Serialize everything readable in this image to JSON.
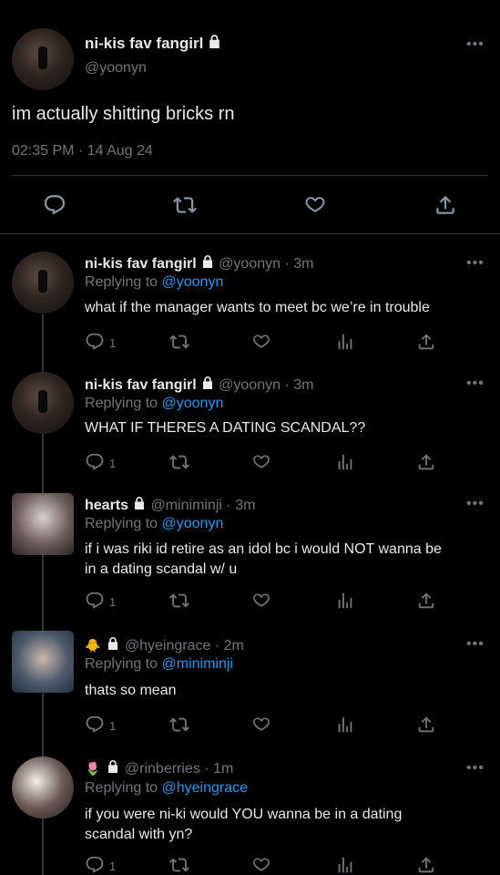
{
  "main": {
    "author_name": "ni-kis fav fangirl",
    "author_handle": "@yoonyn",
    "text": "im actually shitting bricks rn",
    "timestamp": "02:35 PM · 14 Aug 24"
  },
  "replies": [
    {
      "name": "ni-kis fav fangirl",
      "handle": "@yoonyn",
      "time": "· 3m",
      "replying_label": "Replying to",
      "replying_to": "@yoonyn",
      "text_lines": [
        "what if the manager wants to meet bc we’re in trouble"
      ],
      "reply_count": "1"
    },
    {
      "name": "ni-kis fav fangirl",
      "handle": "@yoonyn",
      "time": "· 3m",
      "replying_label": "Replying to",
      "replying_to": "@yoonyn",
      "text_lines": [
        "WHAT IF THERES A DATING SCANDAL??"
      ],
      "reply_count": "1"
    },
    {
      "name": "hearts",
      "handle": "@miniminji",
      "time": "· 3m",
      "replying_label": "Replying to",
      "replying_to": "@yoonyn",
      "text_lines": [
        "if i was riki id retire as an idol bc i would NOT wanna be",
        "in a dating scandal w/ u"
      ],
      "reply_count": "1"
    },
    {
      "name_emoji": "🐥",
      "handle": "@hyeingrace",
      "time": "· 2m",
      "replying_label": "Replying to",
      "replying_to": "@miniminji",
      "text_lines": [
        "thats so mean"
      ],
      "reply_count": "1"
    },
    {
      "name_emoji": "🌷",
      "handle": "@rinberries",
      "time": "· 1m",
      "replying_label": "Replying to",
      "replying_to": "@hyeingrace",
      "text_lines": [
        "if you were ni-ki would YOU wanna be in a dating",
        "scandal with yn?"
      ],
      "reply_count": "1"
    }
  ],
  "icons": {
    "more": "more-horizontal-icon",
    "lock": "lock-icon",
    "reply": "reply-icon",
    "retweet": "retweet-icon",
    "like": "heart-icon",
    "views": "views-icon",
    "share": "share-icon"
  },
  "colors": {
    "link": "#1d9bf0",
    "muted": "#71767b",
    "text": "#e7e9ea",
    "divider": "#2f3336"
  }
}
